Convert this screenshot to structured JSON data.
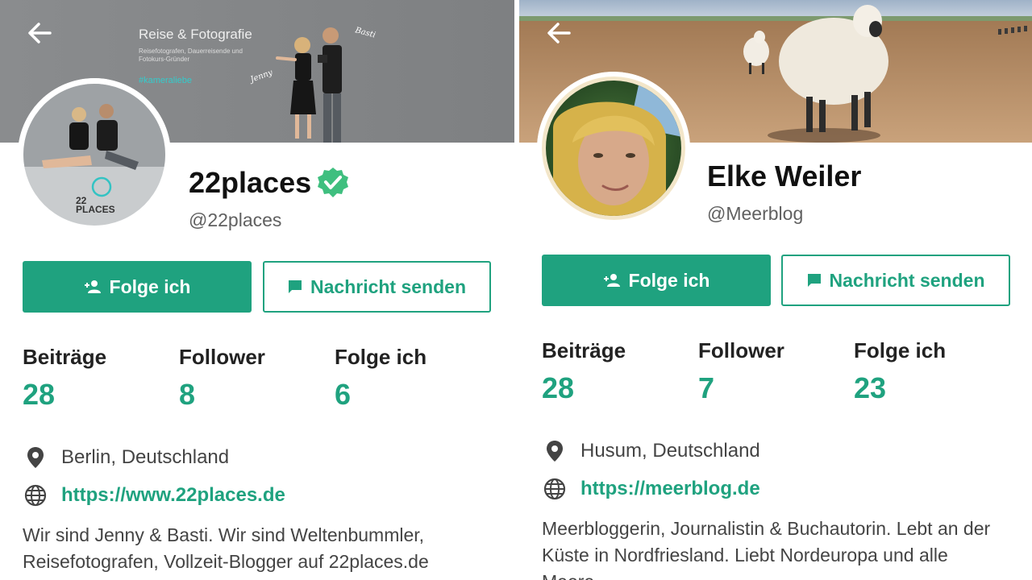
{
  "colors": {
    "accent": "#1fa27f",
    "text": "#111111",
    "muted": "#606060"
  },
  "icons": {
    "back": "arrow-left-icon",
    "verified": "verified-badge-icon",
    "follow": "person-add-icon",
    "message": "chat-bubble-icon",
    "location": "location-pin-icon",
    "website": "globe-icon"
  },
  "left": {
    "cover": {
      "title": "Reise & Fotografie",
      "subtitle_line1": "Reisefotografen, Dauerreisende und",
      "subtitle_line2": "Fotokurs-Gründer",
      "hashtag": "#kameraliebe",
      "scribble_left": "Jenny",
      "scribble_right": "Basti"
    },
    "avatar_logo_line1": "22",
    "avatar_logo_line2": "PLACES",
    "name": "22places",
    "handle": "@22places",
    "follow_label": "Folge ich",
    "message_label": "Nachricht senden",
    "stats": [
      {
        "label": "Beiträge",
        "value": "28"
      },
      {
        "label": "Follower",
        "value": "8"
      },
      {
        "label": "Folge ich",
        "value": "6"
      }
    ],
    "location": "Berlin, Deutschland",
    "website": "https://www.22places.de",
    "bio": "Wir sind Jenny & Basti. Wir sind Weltenbummler, Reisefotografen, Vollzeit-Blogger auf 22places.de"
  },
  "right": {
    "name": "Elke Weiler",
    "handle": "@Meerblog",
    "follow_label": "Folge ich",
    "message_label": "Nachricht senden",
    "stats": [
      {
        "label": "Beiträge",
        "value": "28"
      },
      {
        "label": "Follower",
        "value": "7"
      },
      {
        "label": "Folge ich",
        "value": "23"
      }
    ],
    "location": "Husum, Deutschland",
    "website": "https://meerblog.de",
    "bio": "Meerbloggerin, Journalistin & Buchautorin. Lebt an der Küste in Nordfriesland. Liebt Nordeuropa und alle Meere"
  }
}
